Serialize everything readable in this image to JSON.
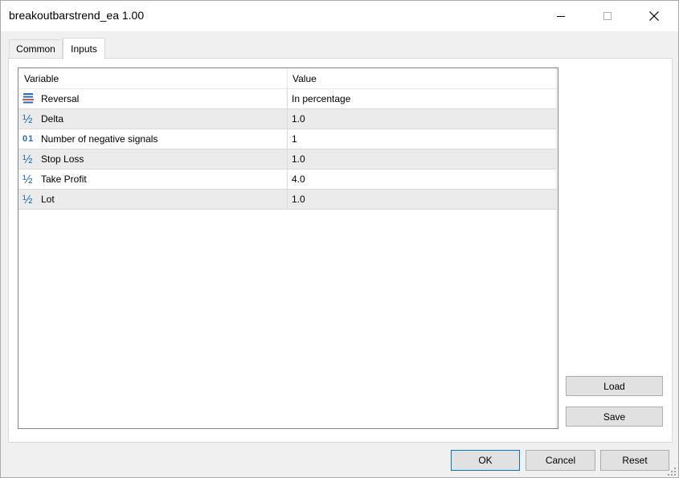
{
  "window": {
    "title": "breakoutbarstrend_ea 1.00"
  },
  "tabs": [
    {
      "label": "Common",
      "active": false
    },
    {
      "label": "Inputs",
      "active": true
    }
  ],
  "grid": {
    "columns": [
      "Variable",
      "Value"
    ],
    "rows": [
      {
        "icon": "enum-list-icon",
        "variable": "Reversal",
        "value": "In percentage"
      },
      {
        "icon": "fraction-icon",
        "variable": "Delta",
        "value": "1.0"
      },
      {
        "icon": "integer-icon",
        "variable": "Number of negative signals",
        "value": "1"
      },
      {
        "icon": "fraction-icon",
        "variable": "Stop Loss",
        "value": "1.0"
      },
      {
        "icon": "fraction-icon",
        "variable": "Take Profit",
        "value": "4.0"
      },
      {
        "icon": "fraction-icon",
        "variable": "Lot",
        "value": "1.0"
      }
    ]
  },
  "side_buttons": {
    "load": "Load",
    "save": "Save"
  },
  "footer_buttons": {
    "ok": "OK",
    "cancel": "Cancel",
    "reset": "Reset"
  },
  "colors": {
    "icon_blue": "#1e6fb8",
    "row_alt": "#ebebeb",
    "ok_border": "#0078d7"
  }
}
